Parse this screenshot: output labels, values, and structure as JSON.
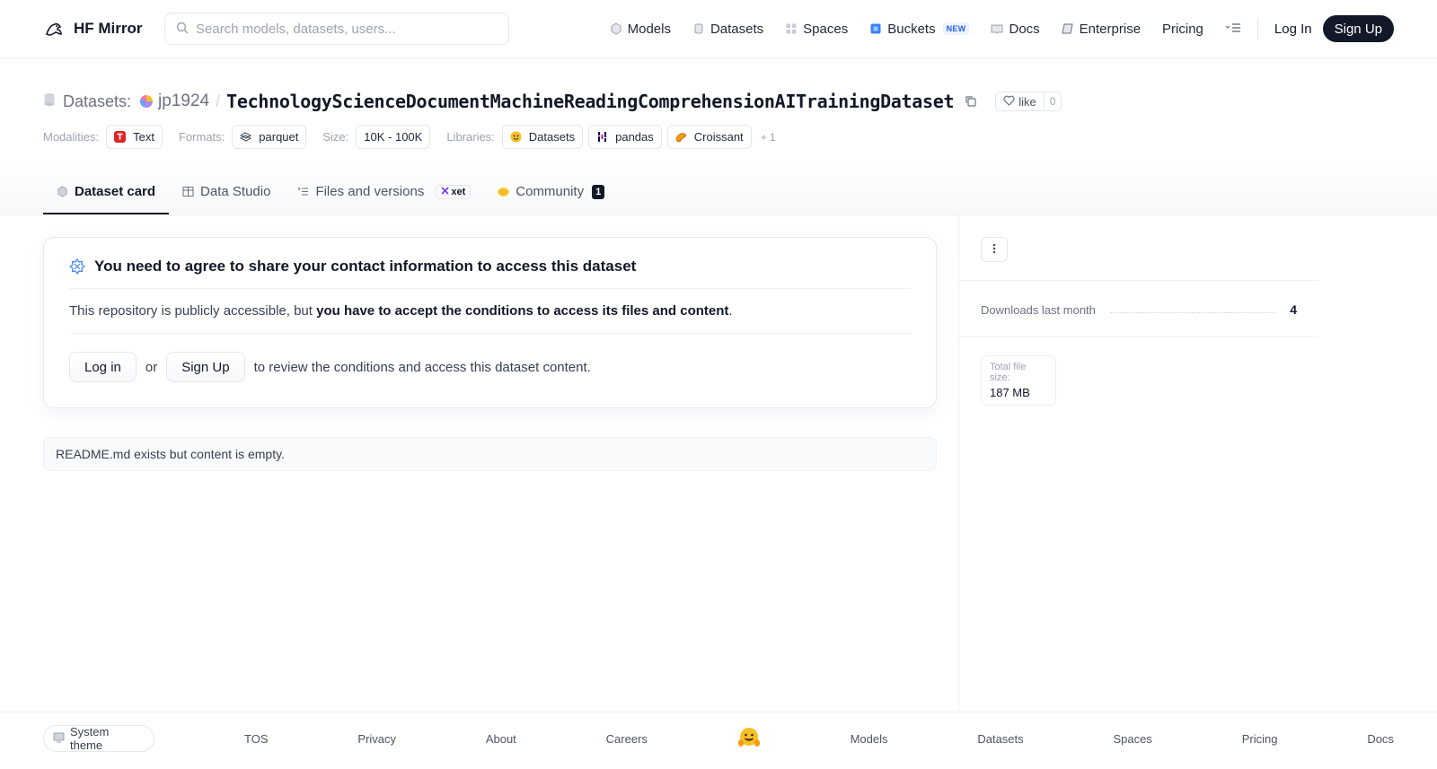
{
  "header": {
    "brand": "HF Mirror",
    "search_placeholder": "Search models, datasets, users...",
    "nav": {
      "models": "Models",
      "datasets": "Datasets",
      "spaces": "Spaces",
      "buckets": "Buckets",
      "buckets_badge": "NEW",
      "docs": "Docs",
      "enterprise": "Enterprise",
      "pricing": "Pricing"
    },
    "login": "Log In",
    "signup": "Sign Up"
  },
  "repo": {
    "type_label": "Datasets:",
    "owner": "jp1924",
    "separator": "/",
    "name": "TechnologyScienceDocumentMachineReadingComprehensionAITrainingDataset",
    "like_label": "like",
    "like_count": "0"
  },
  "meta": {
    "modalities_label": "Modalities:",
    "modality": "Text",
    "formats_label": "Formats:",
    "format": "parquet",
    "size_label": "Size:",
    "size": "10K - 100K",
    "libraries_label": "Libraries:",
    "libraries": [
      "Datasets",
      "pandas",
      "Croissant"
    ],
    "more": "+ 1"
  },
  "tabs": {
    "dataset_card": "Dataset card",
    "data_studio": "Data Studio",
    "files": "Files and versions",
    "xet": "xet",
    "community": "Community",
    "community_count": "1"
  },
  "gate": {
    "title": "You need to agree to share your contact information to access this dataset",
    "desc_prefix": "This repository is publicly accessible, but ",
    "desc_bold": "you have to accept the conditions to access its files and content",
    "desc_suffix": ".",
    "login": "Log in",
    "or": "or",
    "signup": "Sign Up",
    "tail": "to review the conditions and access this dataset content."
  },
  "readme": "README.md exists but content is empty.",
  "sidebar": {
    "downloads_label": "Downloads last month",
    "downloads_value": "4",
    "file_size_label": "Total file size:",
    "file_size_value": "187 MB"
  },
  "footer": {
    "theme": "System theme",
    "links": [
      "TOS",
      "Privacy",
      "About",
      "Careers",
      "Models",
      "Datasets",
      "Spaces",
      "Pricing",
      "Docs"
    ]
  },
  "colors": {
    "primary_dark": "#111827",
    "accent_blue": "#2563eb",
    "border": "#e5e7eb"
  }
}
